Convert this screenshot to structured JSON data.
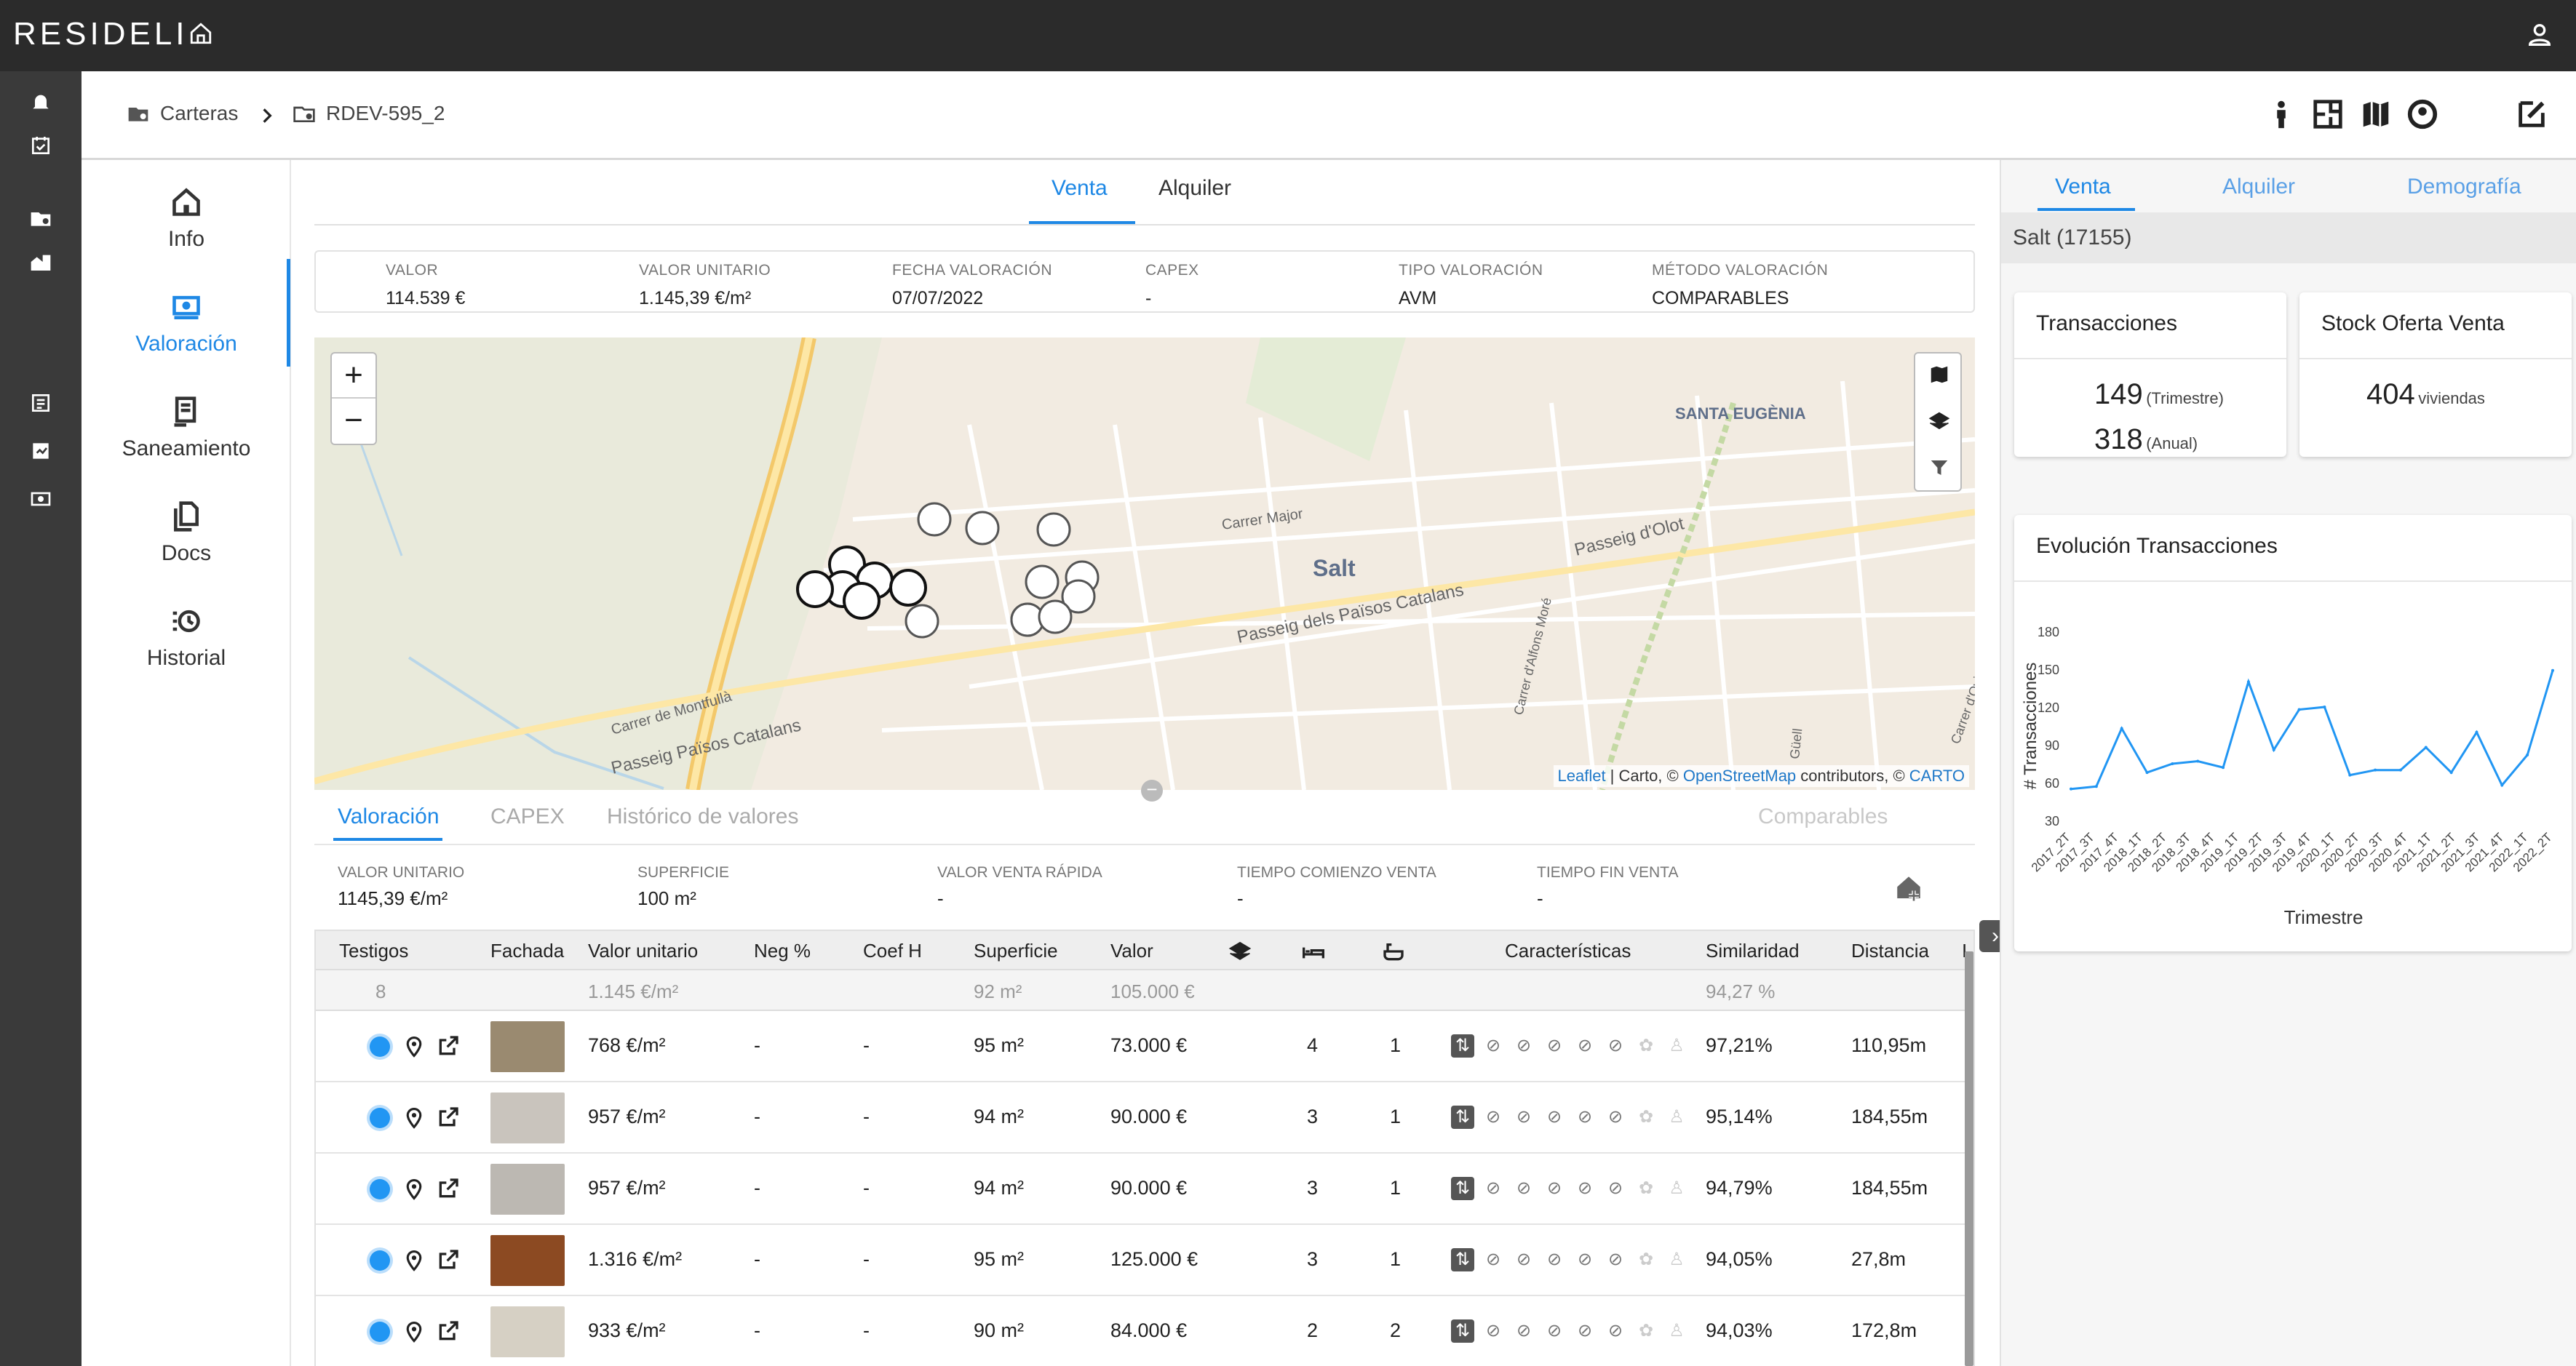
{
  "app": {
    "logo": "RESIDELI"
  },
  "breadcrumb": {
    "root": "Carteras",
    "current": "RDEV-595_2"
  },
  "nav": {
    "items": [
      {
        "label": "Info"
      },
      {
        "label": "Valoración"
      },
      {
        "label": "Saneamiento"
      },
      {
        "label": "Docs"
      },
      {
        "label": "Historial"
      }
    ]
  },
  "main": {
    "tabs": [
      "Venta",
      "Alquiler"
    ],
    "summary": [
      {
        "key": "VALOR",
        "value": "114.539 €"
      },
      {
        "key": "VALOR UNITARIO",
        "value": "1.145,39 €/m²"
      },
      {
        "key": "FECHA VALORACIÓN",
        "value": "07/07/2022"
      },
      {
        "key": "CAPEX",
        "value": "-"
      },
      {
        "key": "TIPO VALORACIÓN",
        "value": "AVM"
      },
      {
        "key": "MÉTODO VALORACIÓN",
        "value": "COMPARABLES"
      }
    ],
    "map": {
      "zoom_in": "+",
      "zoom_out": "−",
      "labels": {
        "district": "SANTA EUGÈNIA",
        "town": "Salt",
        "street1": "Carrer Major",
        "street2": "Passeig d'Olot",
        "street3": "Passeig dels Països Catalans",
        "street4": "Carrer de Montfullà",
        "street5": "Passeig Països Catalans",
        "street6": "Carrer d'Alfons Moré",
        "street7": "Güell",
        "street8": "Carrer d'Oviedo"
      },
      "attribution": {
        "leaflet": "Leaflet",
        "mid": " | Carto, © ",
        "osm": "OpenStreetMap",
        "contrib": " contributors, © ",
        "carto": "CARTO"
      }
    },
    "subtabs": [
      "Valoración",
      "CAPEX",
      "Histórico de valores",
      "Comparables"
    ],
    "stats": [
      {
        "key": "VALOR UNITARIO",
        "value": "1145,39 €/m²"
      },
      {
        "key": "SUPERFICIE",
        "value": "100 m²"
      },
      {
        "key": "VALOR VENTA RÁPIDA",
        "value": "-"
      },
      {
        "key": "TIEMPO COMIENZO VENTA",
        "value": "-"
      },
      {
        "key": "TIEMPO FIN VENTA",
        "value": "-"
      }
    ],
    "table": {
      "headers": {
        "testigos": "Testigos",
        "fachada": "Fachada",
        "valor_unitario": "Valor unitario",
        "neg": "Neg %",
        "coef": "Coef H",
        "superficie": "Superficie",
        "valor": "Valor",
        "caracteristicas": "Características",
        "similaridad": "Similaridad",
        "distancia": "Distancia",
        "extra": "I"
      },
      "summary": {
        "testigos": "8",
        "valor_unitario": "1.145 €/m²",
        "superficie": "92 m²",
        "valor": "105.000 €",
        "similaridad": "94,27 %"
      },
      "rows": [
        {
          "valor_unitario": "768 €/m²",
          "neg": "-",
          "coef": "-",
          "superficie": "95 m²",
          "valor": "73.000 €",
          "hab": "4",
          "banos": "1",
          "similaridad": "97,21%",
          "distancia": "110,95m",
          "photo": "#9a8a70"
        },
        {
          "valor_unitario": "957 €/m²",
          "neg": "-",
          "coef": "-",
          "superficie": "94 m²",
          "valor": "90.000 €",
          "hab": "3",
          "banos": "1",
          "similaridad": "95,14%",
          "distancia": "184,55m",
          "photo": "#c9c4bd"
        },
        {
          "valor_unitario": "957 €/m²",
          "neg": "-",
          "coef": "-",
          "superficie": "94 m²",
          "valor": "90.000 €",
          "hab": "3",
          "banos": "1",
          "similaridad": "94,79%",
          "distancia": "184,55m",
          "photo": "#bcb8b2"
        },
        {
          "valor_unitario": "1.316 €/m²",
          "neg": "-",
          "coef": "-",
          "superficie": "95 m²",
          "valor": "125.000 €",
          "hab": "3",
          "banos": "1",
          "similaridad": "94,05%",
          "distancia": "27,8m",
          "photo": "#8c4a22"
        },
        {
          "valor_unitario": "933 €/m²",
          "neg": "-",
          "coef": "-",
          "superficie": "90 m²",
          "valor": "84.000 €",
          "hab": "2",
          "banos": "2",
          "similaridad": "94,03%",
          "distancia": "172,8m",
          "photo": "#d6d0c4"
        }
      ]
    }
  },
  "right": {
    "tabs": [
      "Venta",
      "Alquiler",
      "Demografía"
    ],
    "location": "Salt (17155)",
    "transacciones": {
      "title": "Transacciones",
      "trimestre_value": "149",
      "trimestre_label": "(Trimestre)",
      "anual_value": "318",
      "anual_label": "(Anual)"
    },
    "stock": {
      "title": "Stock Oferta Venta",
      "value": "404",
      "unit": "viviendas"
    },
    "evolucion": {
      "title": "Evolución Transacciones"
    }
  },
  "chart_data": {
    "type": "line",
    "title": "Evolución Transacciones",
    "xlabel": "Trimestre",
    "ylabel": "# Transacciones",
    "ylim": [
      30,
      180
    ],
    "yticks": [
      30,
      60,
      90,
      120,
      150,
      180
    ],
    "color": "#2196f3",
    "categories": [
      "2017_2T",
      "2017_3T",
      "2017_4T",
      "2018_1T",
      "2018_2T",
      "2018_3T",
      "2018_4T",
      "2019_1T",
      "2019_2T",
      "2019_3T",
      "2019_4T",
      "2020_1T",
      "2020_2T",
      "2020_3T",
      "2020_4T",
      "2021_1T",
      "2021_2T",
      "2021_3T",
      "2021_4T",
      "2022_1T"
    ],
    "x": [
      "2017_2T",
      "2017_3T",
      "2017_4T",
      "2018_1T",
      "2018_2T",
      "2018_3T",
      "2018_4T",
      "2019_1T",
      "2019_2T",
      "2019_3T",
      "2019_4T",
      "2020_1T",
      "2020_2T",
      "2020_3T",
      "2020_4T",
      "2021_1T",
      "2021_2T",
      "2021_3T",
      "2021_4T",
      "2022_1T",
      "2022_2T"
    ],
    "values": [
      55,
      57,
      103,
      68,
      75,
      77,
      72,
      140,
      86,
      118,
      120,
      66,
      70,
      70,
      88,
      68,
      100,
      58,
      82,
      149
    ],
    "series": [
      {
        "values": [
          55,
          57,
          103,
          68,
          75,
          77,
          72,
          140,
          86,
          118,
          120,
          66,
          70,
          70,
          88,
          68,
          100,
          58,
          82,
          149
        ]
      }
    ]
  }
}
